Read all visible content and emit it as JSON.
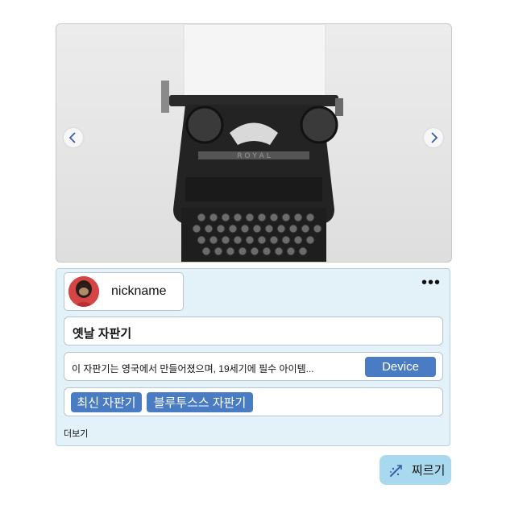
{
  "post": {
    "author": {
      "nickname": "nickname"
    },
    "title": "옛날 자판기",
    "description": "이 자판기는 영국에서 만들어졌으며, 19세기에 필수 아이템...",
    "category_button": "Device",
    "tags": [
      "최신 자판기",
      "블루투스스 자판기"
    ],
    "more_link": "더보기",
    "poke_label": "찌르기",
    "menu_glyph": "•••"
  },
  "colors": {
    "accent": "#4a7cc4",
    "card_bg": "#e3f2f9",
    "poke_bg": "#a9d9ee"
  },
  "icons": [
    "chevron-left-icon",
    "chevron-right-icon",
    "more-icon",
    "poke-icon"
  ]
}
